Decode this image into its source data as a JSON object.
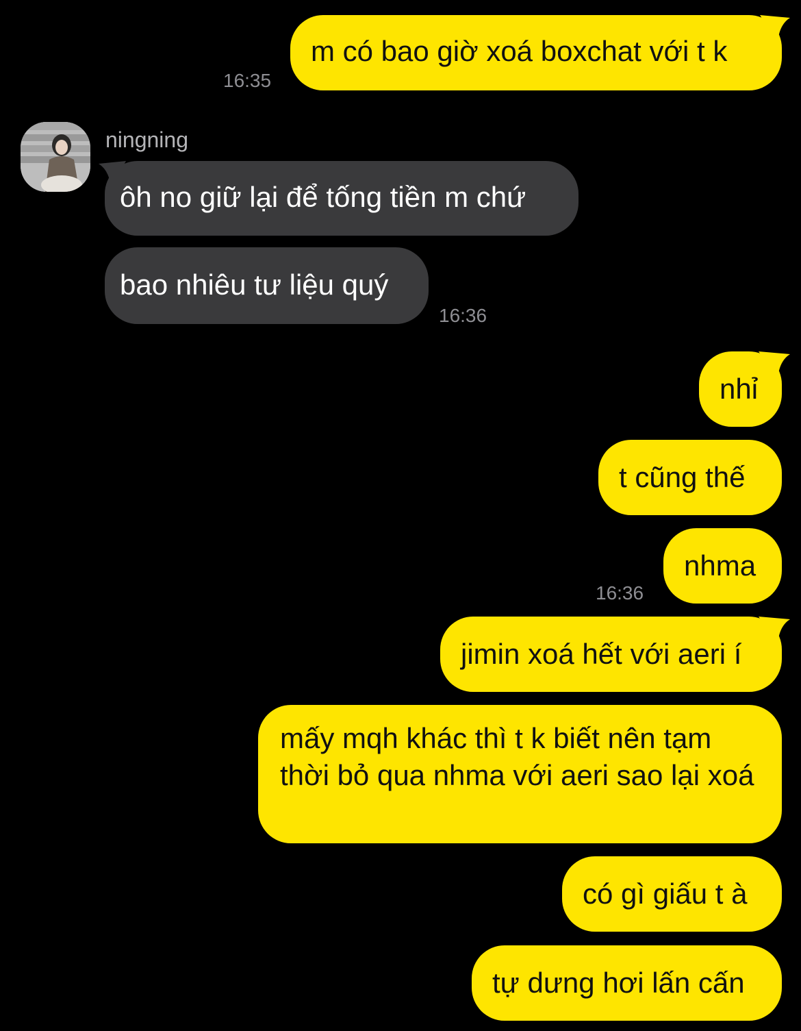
{
  "chat": {
    "partner": {
      "name": "ningning",
      "avatar_icon": "profile-photo"
    },
    "colors": {
      "background": "#000000",
      "outgoing_bubble": "#FEE500",
      "incoming_bubble": "#3A3A3C",
      "timestamp": "#8E8E93"
    },
    "messages": [
      {
        "from": "me",
        "text": "m có bao giờ xoá boxchat với t k",
        "time": "16:35"
      },
      {
        "from": "ningning",
        "text": "ôh no giữ lại để tống tiền m chứ"
      },
      {
        "from": "ningning",
        "text": "bao nhiêu tư liệu quý",
        "time": "16:36"
      },
      {
        "from": "me",
        "text": "nhỉ"
      },
      {
        "from": "me",
        "text": "t cũng thế"
      },
      {
        "from": "me",
        "text": "nhma",
        "time": "16:36"
      },
      {
        "from": "me",
        "text": "jimin xoá hết với aeri í"
      },
      {
        "from": "me",
        "text": "mấy mqh khác thì t k biết nên tạm thời bỏ qua nhma với aeri sao lại xoá"
      },
      {
        "from": "me",
        "text": "có gì giấu t à"
      },
      {
        "from": "me",
        "text": "tự dưng hơi lấn cấn"
      }
    ]
  }
}
